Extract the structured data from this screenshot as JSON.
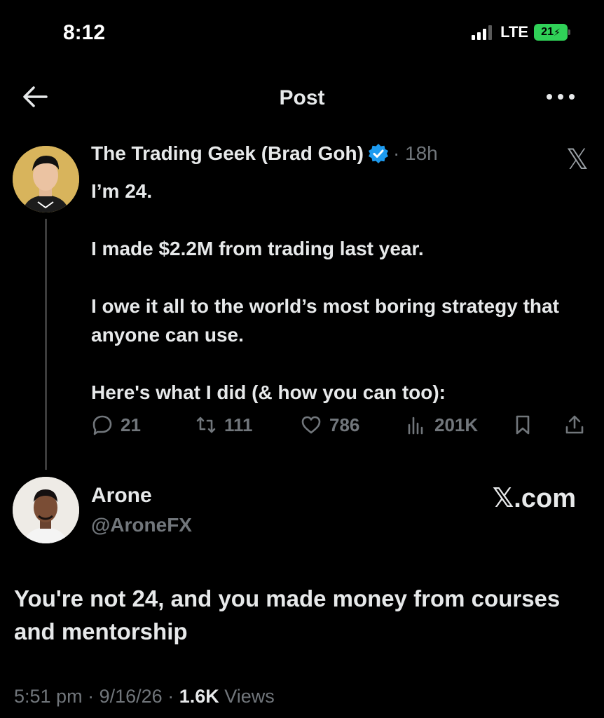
{
  "status_bar": {
    "time": "8:12",
    "network": "LTE",
    "battery": "21"
  },
  "header": {
    "title": "Post",
    "back_icon": "arrow-left-icon",
    "more_icon": "more-horizontal-icon"
  },
  "quoted_post": {
    "author_name": "The Trading Geek (Brad Goh)",
    "verified": true,
    "time": "· 18h",
    "platform_icon": "x-logo-icon",
    "lines": [
      "I’m 24.",
      "",
      "I made $2.2M from trading last year.",
      "",
      "I owe it all to the world’s most boring strategy that anyone can use.",
      "",
      "Here's what I did (& how you can too):"
    ],
    "stats": {
      "replies": "21",
      "reposts": "111",
      "likes": "786",
      "views": "201K"
    }
  },
  "reply": {
    "author_name": "Arone",
    "handle": "@AroneFX",
    "watermark": "𝕏.com",
    "text": "You're not 24, and you made money from courses and mentorship"
  },
  "meta": {
    "time": "5:51 pm",
    "date": "9/16/26",
    "views_count": "1.6K",
    "views_label": "Views"
  },
  "colors": {
    "background": "#000000",
    "text": "#e7e9ea",
    "muted": "#71767b",
    "verified": "#1d9bf0",
    "battery": "#30d158"
  }
}
